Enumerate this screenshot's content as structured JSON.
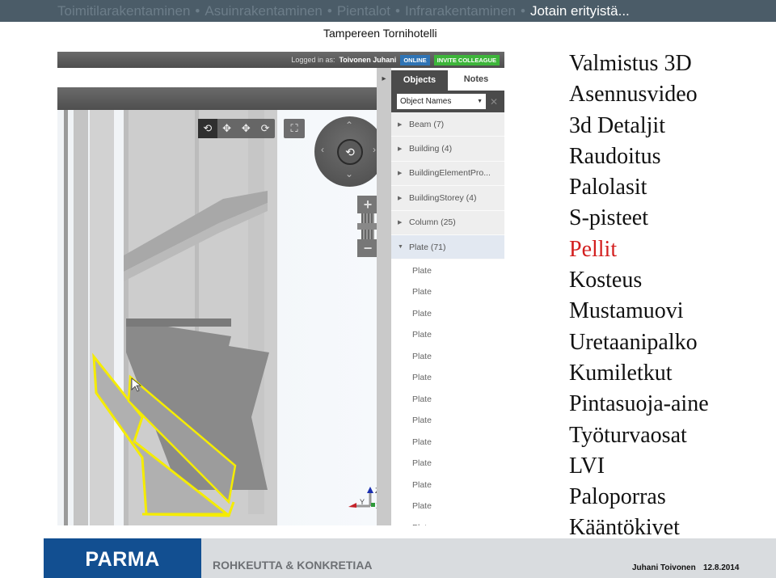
{
  "header": {
    "nav_items": [
      {
        "label": "Toimitilarakentaminen",
        "active": false
      },
      {
        "label": "Asuinrakentaminen",
        "active": false
      },
      {
        "label": "Pientalot",
        "active": false
      },
      {
        "label": "Infrarakentaminen",
        "active": false
      },
      {
        "label": "Jotain erityistä...",
        "active": true
      }
    ],
    "separator": "•",
    "subtitle": "Tampereen Tornihotelli"
  },
  "viewer": {
    "logged_in_label": "Logged in as:",
    "user_name": "Toivonen Juhani",
    "online_badge": "ONLINE",
    "invite_button": "INVITE COLLEAGUE",
    "collapse_icon": "▸",
    "tabs": [
      {
        "label": "Objects",
        "active": true
      },
      {
        "label": "Notes",
        "active": false
      }
    ],
    "filter_select": "Object Names",
    "clear_icon": "✕",
    "tree": [
      {
        "label": "Beam (7)",
        "expanded": false
      },
      {
        "label": "Building (4)",
        "expanded": false
      },
      {
        "label": "BuildingElementPro...",
        "expanded": false
      },
      {
        "label": "BuildingStorey (4)",
        "expanded": false
      },
      {
        "label": "Column (25)",
        "expanded": false
      },
      {
        "label": "Plate (71)",
        "expanded": true
      }
    ],
    "plate_children": [
      "Plate",
      "Plate",
      "Plate",
      "Plate",
      "Plate",
      "Plate",
      "Plate",
      "Plate",
      "Plate",
      "Plate",
      "Plate",
      "Plate",
      "Plate"
    ],
    "toolbar_icons": [
      "⟲",
      "✥",
      "✥",
      "⟳"
    ],
    "fullscreen_icon": "⛶",
    "zoom_in": "+",
    "zoom_out": "−",
    "axes": {
      "z": "Z",
      "y": "Y",
      "x": "X"
    }
  },
  "topics": [
    {
      "label": "Valmistus 3D",
      "highlight": false
    },
    {
      "label": "Asennusvideo",
      "highlight": false
    },
    {
      "label": "3d Detaljit",
      "highlight": false
    },
    {
      "label": "Raudoitus",
      "highlight": false
    },
    {
      "label": "Palolasit",
      "highlight": false
    },
    {
      "label": "S-pisteet",
      "highlight": false
    },
    {
      "label": "Pellit",
      "highlight": true
    },
    {
      "label": "Kosteus",
      "highlight": false
    },
    {
      "label": "Mustamuovi",
      "highlight": false
    },
    {
      "label": "Uretaanipalko",
      "highlight": false
    },
    {
      "label": "Kumiletkut",
      "highlight": false
    },
    {
      "label": "Pintasuoja-aine",
      "highlight": false
    },
    {
      "label": "Työturvaosat",
      "highlight": false
    },
    {
      "label": "LVI",
      "highlight": false
    },
    {
      "label": "Paloporras",
      "highlight": false
    },
    {
      "label": "Kääntökivet",
      "highlight": false
    }
  ],
  "footer": {
    "logo": "PARMA",
    "slogan": "ROHKEUTTA & KONKRETIAA",
    "author": "Juhani Toivonen",
    "date": "12.8.2014"
  },
  "colors": {
    "topbar": "#4b5c68",
    "highlight": "#d31f1f",
    "brand": "#124f91",
    "selection": "#ffee00"
  }
}
